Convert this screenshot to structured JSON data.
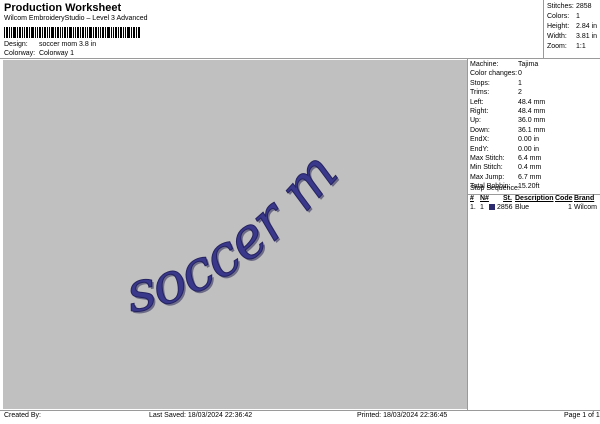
{
  "header": {
    "title": "Production Worksheet",
    "subtitle": "Wilcom EmbroideryStudio – Level 3 Advanced",
    "design_label": "Design:",
    "design_value": "soccer mom 3.8 in",
    "colorway_label": "Colorway:",
    "colorway_value": "Colorway 1"
  },
  "stats": [
    {
      "label": "Stitches:",
      "value": "2858"
    },
    {
      "label": "Colors:",
      "value": "1"
    },
    {
      "label": "Height:",
      "value": "2.84 in"
    },
    {
      "label": "Width:",
      "value": "3.81 in"
    },
    {
      "label": "Zoom:",
      "value": "1:1"
    }
  ],
  "machine": [
    {
      "label": "Machine:",
      "value": "Tajima"
    },
    {
      "label": "Color changes:",
      "value": "0"
    },
    {
      "label": "Stops:",
      "value": "1"
    },
    {
      "label": "Trims:",
      "value": "2"
    },
    {
      "label": "Left:",
      "value": "48.4 mm"
    },
    {
      "label": "Right:",
      "value": "48.4 mm"
    },
    {
      "label": "Up:",
      "value": "36.0 mm"
    },
    {
      "label": "Down:",
      "value": "36.1 mm"
    },
    {
      "label": "EndX:",
      "value": "0.00 in"
    },
    {
      "label": "EndY:",
      "value": "0.00 in"
    },
    {
      "label": "Max Stitch:",
      "value": "6.4 mm"
    },
    {
      "label": "Min Stitch:",
      "value": "0.4 mm"
    },
    {
      "label": "Max Jump:",
      "value": "6.7 mm"
    },
    {
      "label": "Total Bobbin:",
      "value": "15.20ft"
    }
  ],
  "sequence": {
    "title": "Stop Sequence:",
    "headers": {
      "num": "#",
      "n": "N#",
      "st": "St.",
      "description": "Description",
      "code": "Code",
      "brand": "Brand"
    },
    "rows": [
      {
        "num": "1.",
        "n": "1",
        "st": "2856",
        "description": "Blue",
        "code": "1",
        "brand": "Wilcom",
        "color": "#2c2a6e"
      }
    ]
  },
  "design_text": "soccer mom",
  "design_color": "#2c2a6e",
  "footer": {
    "created_by": "Created By:",
    "last_saved": "Last Saved: 18/03/2024 22:36:42",
    "printed": "Printed: 18/03/2024 22:36:45",
    "page": "Page 1 of 1"
  }
}
